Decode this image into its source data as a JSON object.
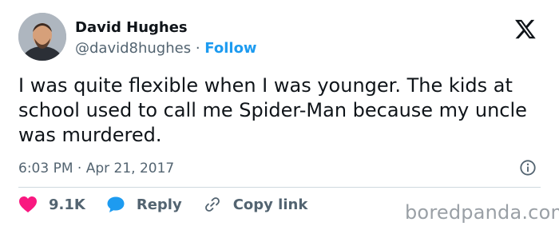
{
  "author": {
    "name": "David Hughes",
    "handle": "@david8hughes",
    "separator": "·",
    "follow_label": "Follow"
  },
  "tweet": {
    "text": "I was quite flexible when I was younger. The kids at school used to call me Spider-Man because my uncle was murdered.",
    "timestamp": "6:03 PM · Apr 21, 2017"
  },
  "actions": {
    "likes": "9.1K",
    "reply_label": "Reply",
    "copy_label": "Copy link"
  },
  "watermark": "boredpanda.com",
  "icons": {
    "platform": "x-logo-icon",
    "like": "heart-icon",
    "reply": "speech-bubble-icon",
    "copy": "link-icon",
    "info": "info-icon"
  },
  "colors": {
    "accent": "#1d9bf0",
    "like": "#f91880",
    "muted": "#536471",
    "text": "#0f1419"
  }
}
